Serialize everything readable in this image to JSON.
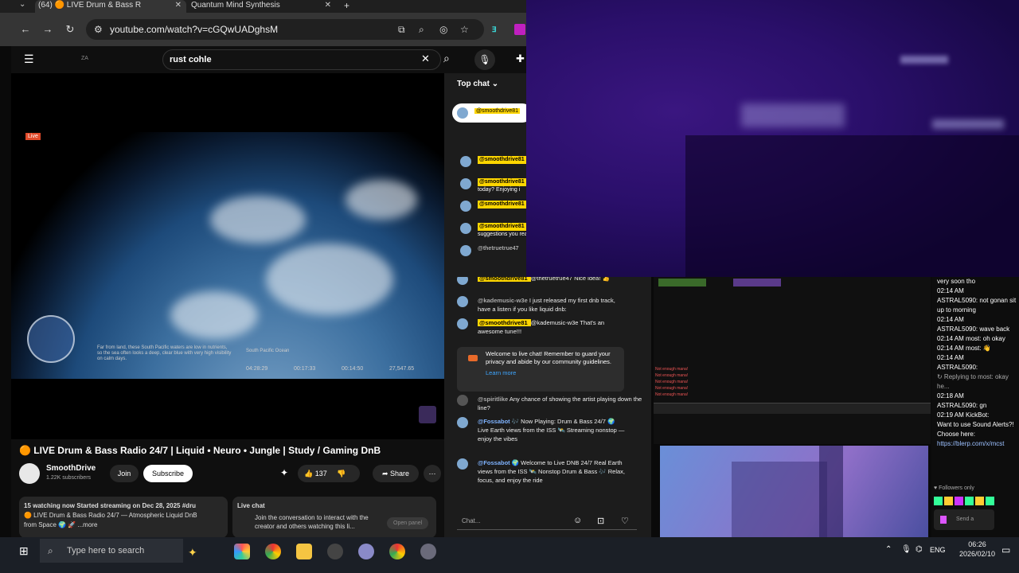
{
  "browser": {
    "tab1_title": "(64) 🟠 LIVE Drum & Bass R",
    "tab2_title": "Quantum Mind Synthesis",
    "new_tab": "+",
    "url": "youtube.com/watch?v=cGQwUADghsM"
  },
  "youtube": {
    "search_value": "rust cohle",
    "video_title": "🟠 LIVE Drum & Bass Radio 24/7 | Liquid • Neuro • Jungle | Study / Gaming DnB",
    "live_badge": "Live",
    "hud_text": "Far from land, these South Pacific waters are low in nutrients, so the sea often looks a deep, clear blue with very high visibility on calm days.",
    "hud_location": "South Pacific Ocean",
    "hud_times": [
      "04:28:29",
      "00:17:33",
      "00:14:50",
      "27,547.65"
    ],
    "channel": "SmoothDrive",
    "subscribers": "1.22K subscribers",
    "join": "Join",
    "subscribe": "Subscribe",
    "likes": "137",
    "share": "Share",
    "desc_line1": "15 watching now  Started streaming on Dec 28, 2025  #dru",
    "desc_line2": "🟠 LIVE Drum & Bass Radio 24/7 — Atmospheric Liquid DnB",
    "desc_line3": "from Space 🌍 🚀  ...more",
    "livechat_title": "Live chat",
    "livechat_body": "Join the conversation to interact with the creator and others watching this li...",
    "open_panel": "Open panel",
    "top_chat": "Top chat",
    "chat_handle": "@smoothdrive81"
  },
  "ytchat": {
    "messages": [
      {
        "name": "@smoothdrive81",
        "text": "",
        "style": "nm"
      },
      {
        "name": "@smoothdrive81",
        "text": "today? Enjoying i",
        "style": "nm"
      },
      {
        "name": "@smoothdrive81",
        "text": "",
        "style": "nm"
      },
      {
        "name": "@smoothdrive81",
        "text": "suggestions you really much appr",
        "style": "nm"
      },
      {
        "name": "@thetruetrue47",
        "text": "",
        "style": "gr"
      },
      {
        "name": "@smoothdrive81",
        "text": "@thetruetrue47 Nice idea! 👍",
        "style": "nm"
      },
      {
        "name": "@kademusic-w3e",
        "text": "I just released my first dnb track, have a listen if you like liquid dnb:",
        "style": "gr"
      },
      {
        "name": "@smoothdrive81",
        "text": "@kademusic-w3e That's an awesome tune!!!",
        "style": "nm"
      }
    ],
    "welcome": "Welcome to live chat! Remember to guard your privacy and abide by our community guidelines.",
    "learn_more": "Learn more",
    "spirit_name": "@spiritlike",
    "spirit_text": "Any chance of showing the artist playing down the line?",
    "fossa1_name": "@Fossabot",
    "fossa1_text": "🎶 Now Playing: Drum & Bass 24/7 🌍 Live Earth views from the ISS 🛰️ Streaming nonstop — enjoy the vibes",
    "fossa2_name": "@Fossabot",
    "fossa2_text": "🌍 Welcome to Live DNB 24/7 Real Earth views from the ISS 🛰️ Nonstop Drum & Bass 🎶 Relax, focus, and enjoy the ride",
    "chat_placeholder": "Chat..."
  },
  "kick": {
    "lines": [
      {
        "t": "very soon tho",
        "c": "#fff"
      },
      {
        "t": "02:14 AM",
        "c": "#fff"
      },
      {
        "t": "ASTRAL5090: not gonan sit up to morning",
        "c": "#fff"
      },
      {
        "t": "02:14 AM",
        "c": "#fff"
      },
      {
        "t": "ASTRAL5090: wave back",
        "c": "#fff"
      },
      {
        "t": "02:14 AM  most: oh okay",
        "c": "#fff"
      },
      {
        "t": "02:14 AM  most: 👋",
        "c": "#fff"
      },
      {
        "t": "02:14 AM",
        "c": "#fff"
      },
      {
        "t": "ASTRAL5090:",
        "c": "#fff"
      },
      {
        "t": "↻ Replying to most: okay he...",
        "c": "#aaa"
      },
      {
        "t": "02:18 AM",
        "c": "#fff"
      },
      {
        "t": "ASTRAL5090: gn",
        "c": "#fff"
      },
      {
        "t": "02:19 AM  KickBot:",
        "c": "#fff"
      },
      {
        "t": "Want to use Sound Alerts?! Choose here:",
        "c": "#fff"
      },
      {
        "t": "https://blerp.com/x/mcst",
        "c": "#9cc0ff"
      }
    ],
    "followers_only": "♥ Followers only",
    "send": "Send a message"
  },
  "game": {
    "status": "Not enough mana!"
  },
  "taskbar": {
    "search_placeholder": "Type here to search",
    "lang": "ENG",
    "time": "06:26",
    "date": "2026/02/10"
  }
}
